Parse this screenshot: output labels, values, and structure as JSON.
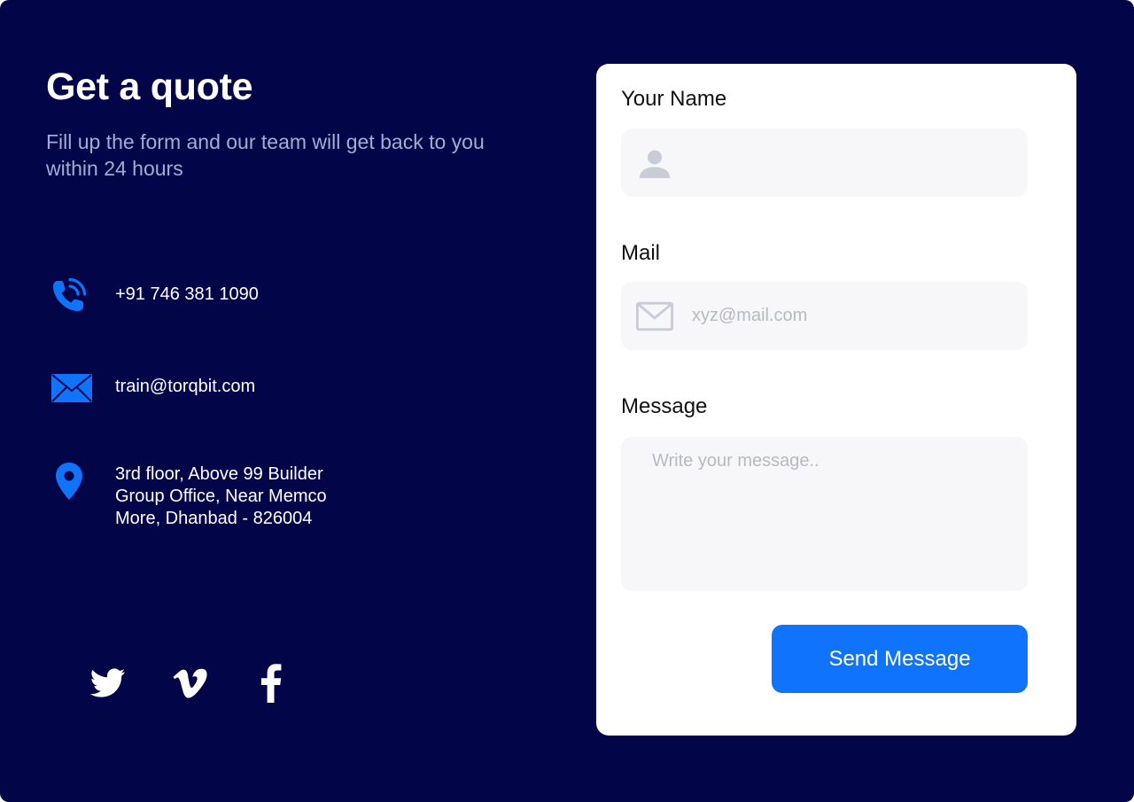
{
  "colors": {
    "background": "#020548",
    "accent": "#0f74fb",
    "card": "#ffffff",
    "field": "#f7f7fa"
  },
  "header": {
    "title": "Get a quote",
    "subtitle": "Fill up the form and our team will get back to you within 24 hours"
  },
  "contact": {
    "phone": {
      "icon": "phone-icon",
      "text": "+91 746 381 1090"
    },
    "email": {
      "icon": "mail-icon",
      "text": "train@torqbit.com"
    },
    "address": {
      "icon": "location-pin-icon",
      "text": "3rd floor, Above 99 Builder Group Office, Near Memco More, Dhanbad - 826004"
    }
  },
  "socials": [
    {
      "icon": "twitter-icon"
    },
    {
      "icon": "vimeo-icon"
    },
    {
      "icon": "facebook-icon"
    }
  ],
  "form": {
    "name": {
      "label": "Your Name",
      "value": "",
      "placeholder": "",
      "icon": "user-icon"
    },
    "mail": {
      "label": "Mail",
      "value": "",
      "placeholder": "xyz@mail.com",
      "icon": "envelope-icon"
    },
    "message": {
      "label": "Message",
      "value": "",
      "placeholder": "Write your message.."
    },
    "submit_label": "Send Message"
  }
}
